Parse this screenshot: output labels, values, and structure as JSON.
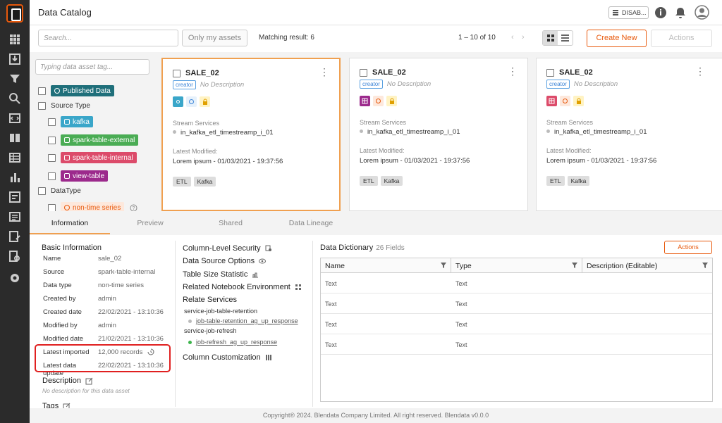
{
  "header": {
    "title": "Data Catalog",
    "status_label": "DISAB..."
  },
  "toolbar": {
    "search_placeholder": "Search...",
    "only_my_assets": "Only my assets",
    "matching": "Matching result: 6",
    "pagination": "1 – 10 of 10",
    "create_new": "Create New",
    "actions": "Actions"
  },
  "filter": {
    "tag_placeholder": "Typing data asset tag...",
    "published": "Published Data",
    "source_type": "Source Type",
    "sources": [
      "kafka",
      "spark-table-external",
      "spark-table-internal",
      "view-table"
    ],
    "data_type": "DataType",
    "non_time": "non-time series"
  },
  "cards": [
    {
      "name": "SALE_02",
      "creator": "creator",
      "desc": "No Description",
      "stream_label": "Stream Services",
      "stream": "in_kafka_etl_timestreamp_i_01",
      "modified_label": "Latest Modified:",
      "modified": "Lorem ipsum - 01/03/2021 - 19:37:56",
      "tags": [
        "ETL",
        "Kafka"
      ]
    },
    {
      "name": "SALE_02",
      "creator": "creator",
      "desc": "No Description",
      "stream_label": "Stream Services",
      "stream": "in_kafka_etl_timestreamp_i_01",
      "modified_label": "Latest Modified:",
      "modified": "Lorem ipsum - 01/03/2021 - 19:37:56",
      "tags": [
        "ETL",
        "Kafka"
      ]
    },
    {
      "name": "SALE_02",
      "creator": "creator",
      "desc": "No Description",
      "stream_label": "Stream Services",
      "stream": "in_kafka_etl_timestreamp_i_01",
      "modified_label": "Latest Modified:",
      "modified": "Lorem ipsum - 01/03/2021 - 19:37:56",
      "tags": [
        "ETL",
        "Kafka"
      ]
    }
  ],
  "tabs": [
    "Information",
    "Preview",
    "Shared",
    "Data Lineage"
  ],
  "basic": {
    "title": "Basic Information",
    "rows": [
      {
        "k": "Name",
        "v": "sale_02"
      },
      {
        "k": "Source",
        "v": "spark-table-internal"
      },
      {
        "k": "Data type",
        "v": "non-time series"
      },
      {
        "k": "Created by",
        "v": "admin"
      },
      {
        "k": "Created date",
        "v": "22/02/2021 - 13:10:36"
      },
      {
        "k": "Modified by",
        "v": "admin"
      },
      {
        "k": "Modified date",
        "v": "21/02/2021 - 13:10:36"
      },
      {
        "k": "Latest imported",
        "v": "12,000  records"
      },
      {
        "k": "Latest data update",
        "v": "22/02/2021 - 13:10:36"
      }
    ],
    "description_title": "Description",
    "description": "No description for this data asset",
    "tags_title": "Tags"
  },
  "middle": {
    "column_security": "Column-Level Security",
    "data_source_options": "Data Source Options",
    "table_size": "Table Size Statistic",
    "notebook": "Related Notebook Environment",
    "relate_services": "Relate Services",
    "svc1": "service-job-table-retention",
    "svc1_link": "job-table-retention_ag_up_response",
    "svc2": "service-job-refresh",
    "svc2_link": "job-refresh_ag_up_response",
    "column_customization": "Column Customization"
  },
  "dictionary": {
    "title": "Data Dictionary",
    "count": "26 Fields",
    "actions": "Actions",
    "headers": [
      "Name",
      "Type",
      "Description (Editable)"
    ],
    "rows": [
      [
        "Text",
        "Text"
      ],
      [
        "Text",
        "Text"
      ],
      [
        "Text",
        "Text"
      ],
      [
        "Text",
        "Text"
      ]
    ]
  },
  "footer": "Copyright® 2024. Blendata Company Limited. All right reserved. Blendata v0.0.0",
  "colors": {
    "accent": "#e8590c",
    "sidebar": "#2b2b2b",
    "kafka": "#3aa6c9",
    "ext": "#4aac54",
    "int": "#dc4b6a",
    "view": "#9c2a8c",
    "published": "#1f6f7a"
  }
}
